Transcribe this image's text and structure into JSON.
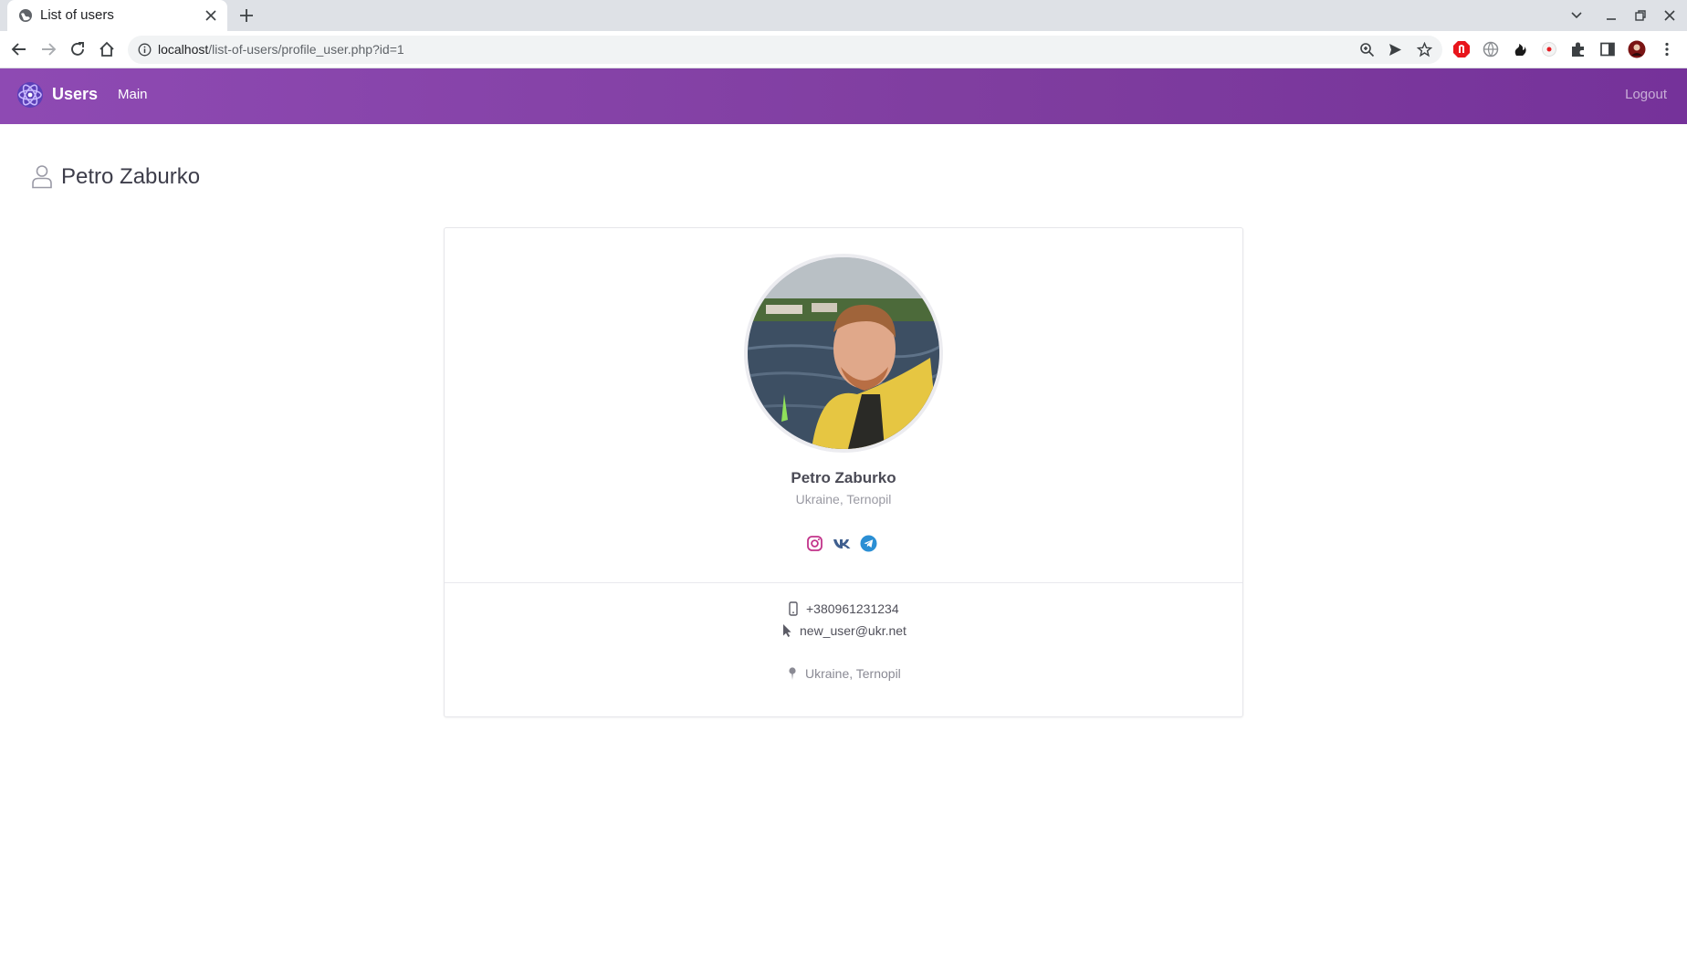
{
  "browser": {
    "tab_title": "List of users",
    "url_host": "localhost",
    "url_path": "/list-of-users/profile_user.php?id=1"
  },
  "navbar": {
    "brand": "Users",
    "main_link": "Main",
    "logout_link": "Logout",
    "gradient_start": "#8e4ab3",
    "gradient_end": "#75329a"
  },
  "page": {
    "title": "Petro Zaburko"
  },
  "profile": {
    "name": "Petro Zaburko",
    "location": "Ukraine, Ternopil",
    "socials": [
      {
        "icon": "instagram-icon",
        "color": "#c2338a"
      },
      {
        "icon": "vk-icon",
        "color": "#3f5f8f"
      },
      {
        "icon": "telegram-icon",
        "color": "#2b8fd4"
      }
    ],
    "phone": "+380961231234",
    "email": "new_user@ukr.net",
    "address": "Ukraine, Ternopil"
  }
}
